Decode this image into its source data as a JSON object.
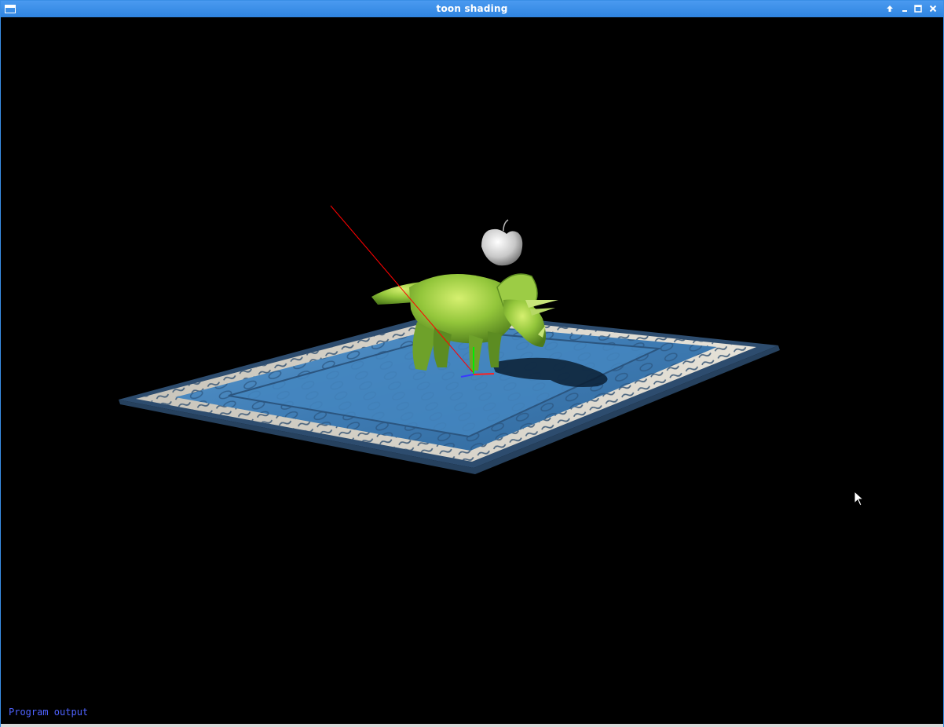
{
  "window": {
    "title": "toon shading",
    "controls": {
      "keep_above_icon": "arrow-up-icon",
      "minimize_icon": "minimize-icon",
      "maximize_icon": "maximize-icon",
      "close_icon": "close-icon"
    },
    "accent_color": "#3a8ee6"
  },
  "viewport": {
    "background_color": "#000000",
    "program_output_label": "Program output",
    "program_output_color": "#4f63ff"
  },
  "scene": {
    "objects": [
      "rug",
      "triceratops",
      "apple",
      "light-ray",
      "axis-gizmo"
    ],
    "rug_color": "#3f79ad",
    "dino_color": "#8fc23a",
    "apple_color": "#d8d8d8"
  }
}
